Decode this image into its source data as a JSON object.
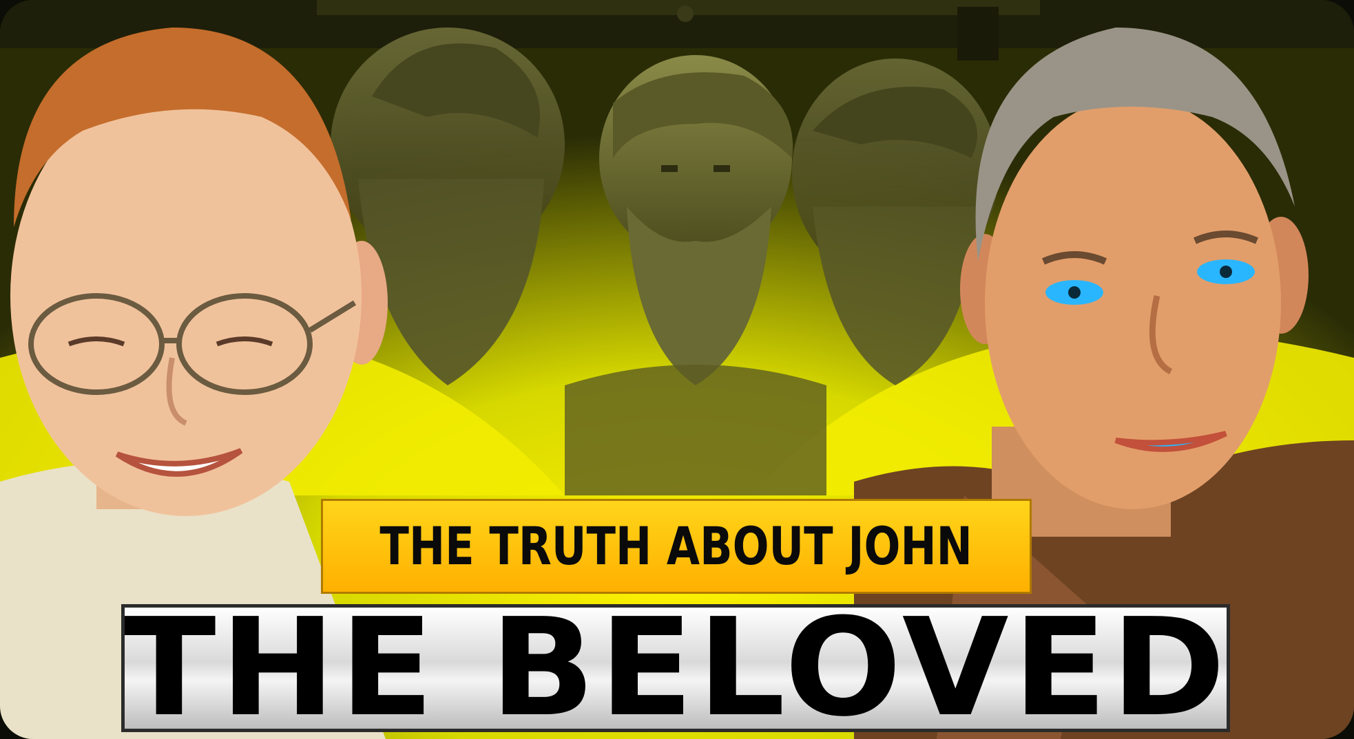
{
  "thumbnail": {
    "headline": "THE TRUTH ABOUT JOHN",
    "title": "THE BELOVED"
  },
  "colors": {
    "accent_yellow": "#ffd51a",
    "background_olive": "#3a3c10",
    "title_text": "#000000",
    "headline_text": "#0a0a0a"
  }
}
